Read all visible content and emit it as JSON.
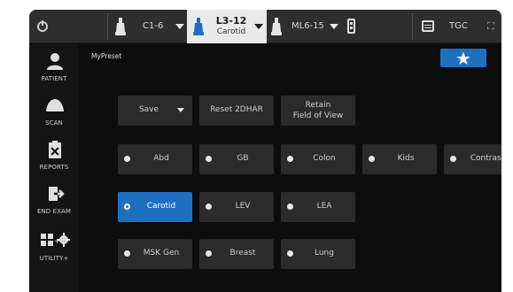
{
  "topbar": {
    "probes": [
      {
        "label": "C1-6"
      },
      {
        "label": "L3-12",
        "sublabel": "Carotid",
        "active": true
      },
      {
        "label": "ML6-15"
      }
    ],
    "tgc_label": "TGC",
    "expand_glyph": "⛶"
  },
  "sidebar": {
    "items": [
      {
        "label": "PATIENT",
        "icon": "patient-icon"
      },
      {
        "label": "SCAN",
        "icon": "scan-icon"
      },
      {
        "label": "REPORTS",
        "icon": "reports-icon"
      },
      {
        "label": "END EXAM",
        "icon": "end-exam-icon"
      },
      {
        "label": "UTILITY+",
        "icon": "utility-icon"
      }
    ]
  },
  "main": {
    "preset_title": "MyPreset",
    "actions": {
      "save": "Save",
      "reset": "Reset 2DHAR",
      "retain_line1": "Retain",
      "retain_line2": "Field of View"
    },
    "presets": [
      {
        "label": "Abd",
        "selected": false
      },
      {
        "label": "GB",
        "selected": false
      },
      {
        "label": "Colon",
        "selected": false
      },
      {
        "label": "Kids",
        "selected": false
      },
      {
        "label": "Contrast",
        "selected": false
      },
      {
        "label": "Carotid",
        "selected": true
      },
      {
        "label": "LEV",
        "selected": false
      },
      {
        "label": "LEA",
        "selected": false
      },
      {
        "label": "MSK Gen",
        "selected": false
      },
      {
        "label": "Breast",
        "selected": false
      },
      {
        "label": "Lung",
        "selected": false
      }
    ]
  },
  "colors": {
    "accent": "#1f6fc1",
    "button_bg": "#2b2b2b",
    "panel_bg": "#0d0d0d"
  }
}
